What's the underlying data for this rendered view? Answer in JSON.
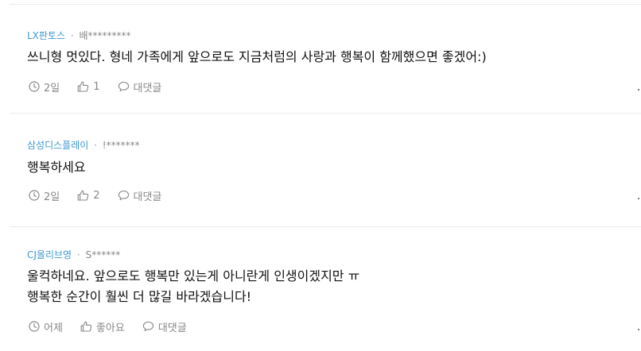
{
  "comments": [
    {
      "company": "LX판토스",
      "separator": "·",
      "author": "배*********",
      "lines": [
        "쓰니형 멋있다. 형네 가족에게 앞으로도 지금처럼의 사랑과 행복이 함께했으면 좋겠어:)"
      ],
      "time": "2일",
      "like_label": "1",
      "reply_label": "대댓글"
    },
    {
      "company": "삼성디스플레이",
      "separator": "·",
      "author": "!*******",
      "lines": [
        "행복하세요"
      ],
      "time": "2일",
      "like_label": "2",
      "reply_label": "대댓글"
    },
    {
      "company": "CJ올리브영",
      "separator": "·",
      "author": "S******",
      "lines": [
        "울컥하네요. 앞으로도 행복만 있는게 아니란게 인생이겠지만 ㅠ",
        "행복한 순간이 훨씬 더 많길 바라겠습니다!"
      ],
      "time": "어제",
      "like_label": "좋아요",
      "reply_label": "대댓글"
    }
  ],
  "icons": {
    "time": "clock-icon",
    "like": "thumbs-up-icon",
    "reply": "speech-bubble-icon",
    "more": "more-options-icon"
  },
  "colors": {
    "company": "#3d9ad1",
    "meta": "#888888",
    "text": "#111111",
    "divider": "#ececec"
  }
}
